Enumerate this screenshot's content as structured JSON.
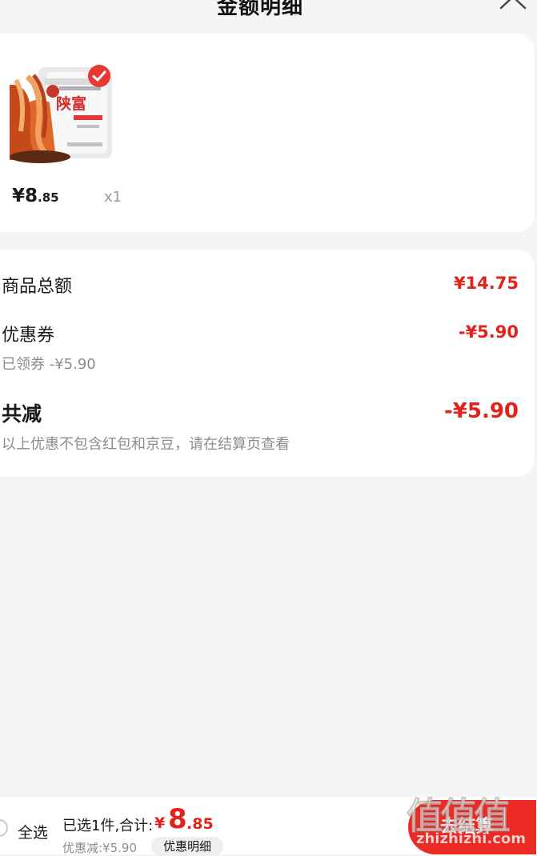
{
  "header": {
    "title": "金额明细",
    "close_icon": "close-icon"
  },
  "product": {
    "image_icon": "product-image",
    "image_label": "陕富",
    "checked_icon": "check-circle-icon",
    "price_int": "¥8",
    "price_dec": ".85",
    "quantity": "x1"
  },
  "summary": {
    "goods_total_label": "商品总额",
    "goods_total_value": "¥14.75",
    "coupon_label": "优惠券",
    "coupon_value": "-¥5.90",
    "coupon_sub": "已领券 -¥5.90",
    "total_reduce_label": "共减",
    "total_reduce_value": "-¥5.90",
    "note": "以上优惠不包含红包和京豆，请在结算页查看"
  },
  "bottom_bar": {
    "select_all_label": "全选",
    "selected_text": "已选1件,合计:",
    "price_currency": "¥",
    "price_int": "8",
    "price_dec": ".85",
    "discount_text": "优惠减:¥5.90",
    "detail_button_label": "优惠明细",
    "checkout_label": "去结算"
  },
  "watermark": {
    "glyphs": "值值值",
    "url": "zhizhizhi.com"
  },
  "colors": {
    "accent": "#e2231a",
    "background": "#f5f5f5",
    "card": "#ffffff"
  }
}
